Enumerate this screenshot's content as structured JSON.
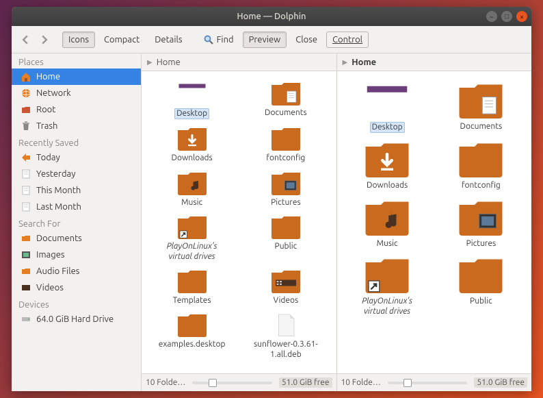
{
  "title": "Home — Dolphin",
  "toolbar": {
    "icons": "Icons",
    "compact": "Compact",
    "details": "Details",
    "find": "Find",
    "preview": "Preview",
    "close": "Close",
    "control": "Control"
  },
  "sidebar": {
    "sections": [
      {
        "header": "Places",
        "items": [
          {
            "label": "Home",
            "icon": "home",
            "selected": true
          },
          {
            "label": "Network",
            "icon": "network"
          },
          {
            "label": "Root",
            "icon": "root"
          },
          {
            "label": "Trash",
            "icon": "trash"
          }
        ]
      },
      {
        "header": "Recently Saved",
        "items": [
          {
            "label": "Today",
            "icon": "today"
          },
          {
            "label": "Yesterday",
            "icon": "doc"
          },
          {
            "label": "This Month",
            "icon": "doc"
          },
          {
            "label": "Last Month",
            "icon": "doc"
          }
        ]
      },
      {
        "header": "Search For",
        "items": [
          {
            "label": "Documents",
            "icon": "folder"
          },
          {
            "label": "Images",
            "icon": "images"
          },
          {
            "label": "Audio Files",
            "icon": "folder"
          },
          {
            "label": "Videos",
            "icon": "videos"
          }
        ]
      },
      {
        "header": "Devices",
        "items": [
          {
            "label": "64.0 GiB Hard Drive",
            "icon": "drive"
          }
        ]
      }
    ]
  },
  "panes": [
    {
      "crumb": "Home",
      "active": false,
      "items": [
        {
          "label": "Desktop",
          "type": "desktop",
          "selected": true
        },
        {
          "label": "Documents",
          "type": "documents"
        },
        {
          "label": "Downloads",
          "type": "downloads"
        },
        {
          "label": "fontconfig",
          "type": "folder"
        },
        {
          "label": "Music",
          "type": "music"
        },
        {
          "label": "Pictures",
          "type": "pictures"
        },
        {
          "label": "PlayOnLinux's virtual drives",
          "type": "link",
          "italic": true
        },
        {
          "label": "Public",
          "type": "folder"
        },
        {
          "label": "Templates",
          "type": "folder"
        },
        {
          "label": "Videos",
          "type": "videos"
        },
        {
          "label": "examples.desktop",
          "type": "folder"
        },
        {
          "label": "sunflower-0.3.61-1.all.deb",
          "type": "file"
        }
      ],
      "status_info": "10 Folde…",
      "status_free": "51.0 GiB free"
    },
    {
      "crumb": "Home",
      "active": true,
      "large": true,
      "items": [
        {
          "label": "Desktop",
          "type": "desktop",
          "selected": true
        },
        {
          "label": "Documents",
          "type": "documents"
        },
        {
          "label": "Downloads",
          "type": "downloads"
        },
        {
          "label": "fontconfig",
          "type": "folder"
        },
        {
          "label": "Music",
          "type": "music"
        },
        {
          "label": "Pictures",
          "type": "pictures"
        },
        {
          "label": "PlayOnLinux's virtual drives",
          "type": "link",
          "italic": true
        },
        {
          "label": "Public",
          "type": "folder"
        }
      ],
      "status_info": "10 Folde…",
      "status_free": "51.0 GiB free"
    }
  ]
}
